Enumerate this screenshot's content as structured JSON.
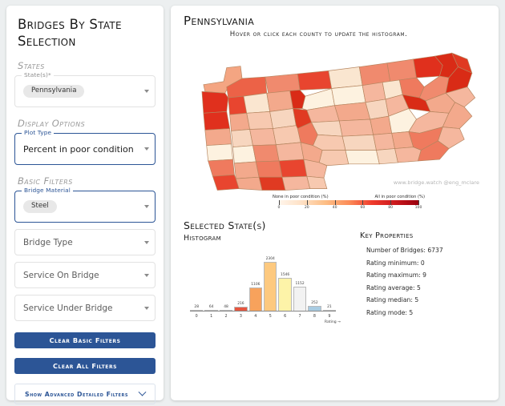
{
  "sidebar": {
    "title": "Bridges By State Selection",
    "sections": {
      "states": "States",
      "display_options": "Display Options",
      "basic_filters": "Basic Filters"
    },
    "fields": {
      "states": {
        "legend": "State(s)*",
        "chip": "Pennsylvania"
      },
      "plot_type": {
        "legend": "Plot Type",
        "value": "Percent in poor condition"
      },
      "bridge_material": {
        "legend": "Bridge Material",
        "chip": "Steel"
      },
      "bridge_type": {
        "placeholder": "Bridge Type"
      },
      "service_on": {
        "placeholder": "Service On Bridge"
      },
      "service_under": {
        "placeholder": "Service Under Bridge"
      }
    },
    "buttons": {
      "clear_basic": "Clear Basic Filters",
      "clear_all": "Clear All Filters",
      "advanced": "Show Advanced Detailed Filters"
    }
  },
  "main": {
    "state_title": "Pennsylvania",
    "subtitle": "Hover or click each county to update the histogram.",
    "watermark": "www.bridge.watch @eng_mclare",
    "colorbar": {
      "left_label": "None in poor condition (%)",
      "right_label": "All in poor condition (%)",
      "ticks": [
        "0",
        "20",
        "40",
        "60",
        "80",
        "100"
      ]
    },
    "selected_states_heading": "Selected State(s)",
    "histogram_heading": "Histogram",
    "key_properties_heading": "Key Properties",
    "properties": [
      "Number of Bridges: 6737",
      "Rating minimum: 0",
      "Rating maximum: 9",
      "Rating average: 5",
      "Rating median: 5",
      "Rating mode: 5"
    ]
  },
  "chart_data": {
    "type": "bar",
    "title": "Histogram",
    "xlabel": "Rating →",
    "ylabel": "",
    "categories": [
      "0",
      "1",
      "2",
      "3",
      "4",
      "5",
      "6",
      "7",
      "8",
      "9"
    ],
    "values": [
      28,
      64,
      48,
      216,
      1106,
      2304,
      1546,
      1152,
      252,
      21
    ],
    "colors": [
      "#b2473a",
      "#c03a2b",
      "#d94b36",
      "#e6563f",
      "#f7a25c",
      "#fdc97f",
      "#fdf3a8",
      "#f2f2f2",
      "#a8cbe2",
      "#6fa8d0"
    ],
    "ylim": [
      0,
      2500
    ],
    "grid": false,
    "legend": "none"
  }
}
